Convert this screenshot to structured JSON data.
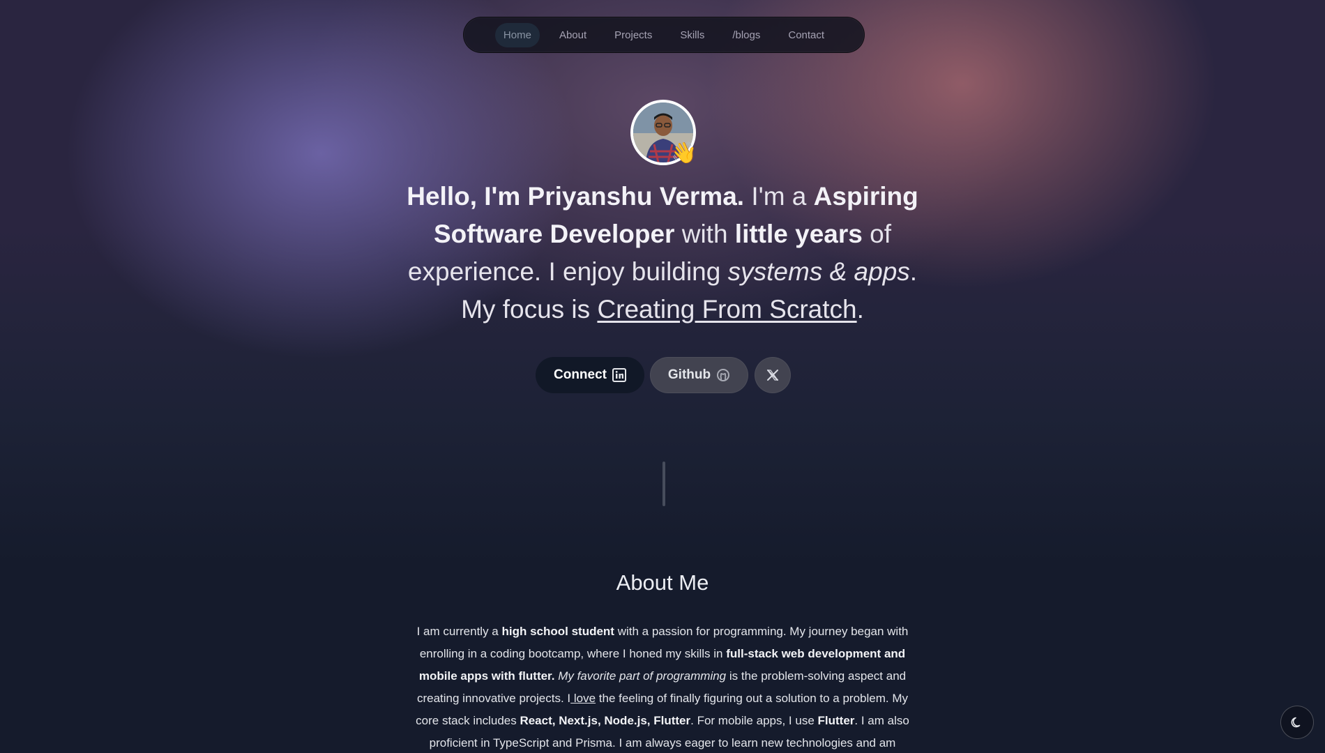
{
  "nav": {
    "items": [
      {
        "label": "Home",
        "active": true
      },
      {
        "label": "About"
      },
      {
        "label": "Projects"
      },
      {
        "label": "Skills"
      },
      {
        "label": "/blogs"
      },
      {
        "label": "Contact"
      }
    ]
  },
  "hero": {
    "avatar_icon": "profile-photo",
    "wave_emoji": "👋",
    "greeting": "Hello, I'm Priyanshu Verma.",
    "im_a": " I'm a ",
    "role": "Aspiring Software Developer",
    "with": " with ",
    "experience": "little years",
    "of_experience": " of experience. I enjoy building ",
    "building": "systems & apps",
    "focus_prefix": ". My focus is ",
    "focus": "Creating From Scratch",
    "focus_suffix": "."
  },
  "buttons": {
    "connect": {
      "label": "Connect",
      "icon": "linkedin-icon"
    },
    "github": {
      "label": "Github",
      "icon": "github-icon"
    },
    "x": {
      "icon": "x-icon"
    }
  },
  "about": {
    "title": "About Me",
    "p1": "I am currently a ",
    "b1": "high school student",
    "p2": " with a passion for programming. My journey began with enrolling in a coding bootcamp, where I honed my skills in ",
    "b2": "full-stack web development and mobile apps with flutter.",
    "p3": " ",
    "i1": "My favorite part of programming",
    "p4": " is the problem-solving aspect and creating innovative projects. I",
    "u1": " love",
    "p5": " the feeling of finally figuring out a solution to a problem. My core stack includes ",
    "b3": "React, Next.js, Node.js, Flutter",
    "p6": ". For mobile apps, I use ",
    "b4": "Flutter",
    "p7": ". I am also proficient in TypeScript and Prisma. I am always eager to learn new technologies and am"
  },
  "theme_toggle": {
    "icon": "moon-icon"
  },
  "colors": {
    "accent_dark": "#111827",
    "button_gray": "#424350",
    "background_bottom": "#151b2c"
  }
}
